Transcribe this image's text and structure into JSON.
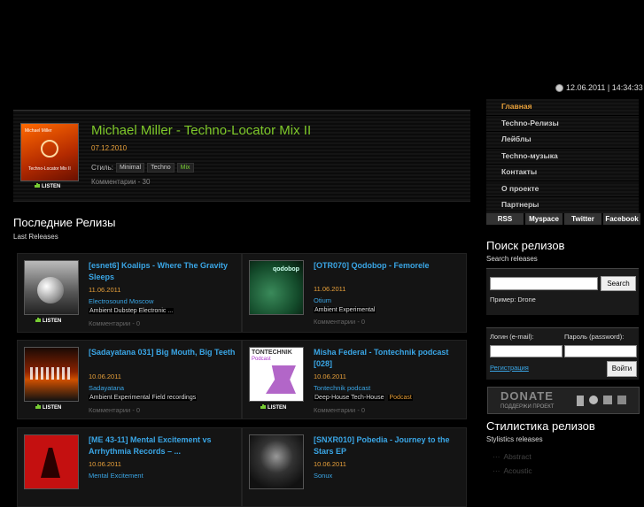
{
  "header": {
    "datetime": "12.06.2011 | 14:34:33"
  },
  "featured": {
    "title": "Michael Miller - Techno-Locator Mix II",
    "date": "07.12.2010",
    "style_label": "Стиль:",
    "tags": [
      "Minimal",
      "Techno",
      "Mix"
    ],
    "comments": "Комментарии - 30",
    "cover_artist": "Michael Miller",
    "cover_title": "Techno-Locator Mix II",
    "listen": "LISTEN"
  },
  "latest": {
    "title": "Последние Релизы",
    "subtitle": "Last Releases"
  },
  "releases": [
    {
      "title": "[esnet6] Koalips - Where The Gravity Sleeps",
      "date": "11.06.2011",
      "label": "Electrosound Moscow",
      "tags": "Ambient  Dubstep  Electronic ...",
      "comments": "Комментарии - 0",
      "listen": "LISTEN"
    },
    {
      "title": "[OTR070] Qodobop - Femorele",
      "date": "11.06.2011",
      "label": "Otium",
      "tags": "Ambient  Experimental",
      "comments": "Комментарии - 0",
      "listen": ""
    },
    {
      "title": "[Sadayatana 031] Big Mouth, Big Teeth",
      "date": "10.06.2011",
      "label": "Sadayatana",
      "tags": "Ambient  Experimental  Field recordings",
      "comments": "Комментарии - 0",
      "listen": "LISTEN"
    },
    {
      "title": "Misha Federal - Tontechnik podcast [028]",
      "date": "10.06.2011",
      "label": "Tontechnik podcast",
      "tags": "Deep-House  Tech-House",
      "tag_extra": "Podcast",
      "comments": "Комментарии - 0",
      "listen": "LISTEN"
    },
    {
      "title": "[ME 43-11] Mental Excitement vs Arrhythmia Records – ...",
      "date": "10.06.2011",
      "label": "Mental Excitement",
      "tags": "",
      "comments": "",
      "listen": ""
    },
    {
      "title": "[SNXR010] Pobedia - Journey to the Stars EP",
      "date": "10.06.2011",
      "label": "Sonux",
      "tags": "",
      "comments": "",
      "listen": ""
    }
  ],
  "menu": [
    "Главная",
    "Techno-Релизы",
    "Лейблы",
    "Techno-музыка",
    "Контакты",
    "О проекте",
    "Партнеры"
  ],
  "social": [
    "RSS",
    "Myspace",
    "Twitter",
    "Facebook"
  ],
  "search": {
    "title": "Поиск релизов",
    "subtitle": "Search releases",
    "button": "Search",
    "example": "Пример: Drone"
  },
  "login": {
    "login_label": "Логин (e-mail):",
    "password_label": "Пароль (password):",
    "register": "Регистрация",
    "button": "Войти"
  },
  "donate": {
    "title": "DONATE",
    "subtitle": "ПОДДЕРЖИ ПРОЕКТ"
  },
  "styles": {
    "title": "Стилистика релизов",
    "subtitle": "Stylistics releases",
    "items": [
      "Abstract",
      "Acoustic"
    ]
  },
  "colors": {
    "accent_orange": "#e8a03a",
    "link_blue": "#3aa6e6",
    "green": "#7ec82a"
  }
}
